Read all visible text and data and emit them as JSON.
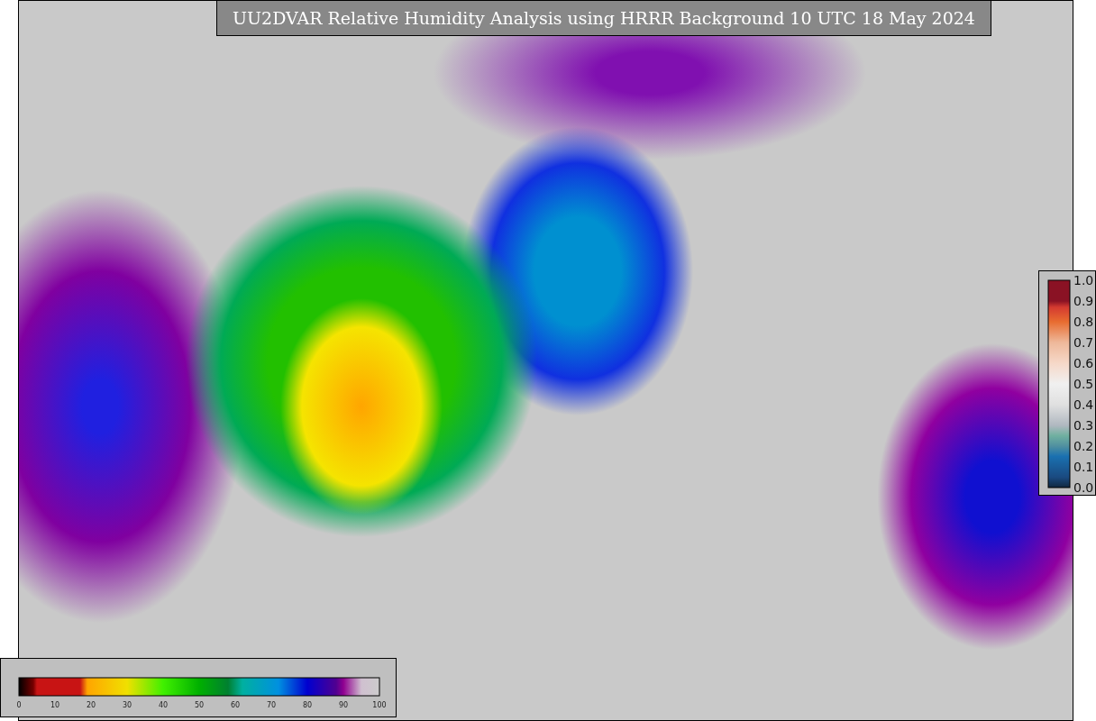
{
  "title": "UU2DVAR Relative Humidity Analysis using HRRR Background 10 UTC 18 May 2024",
  "colorbar_bottom": {
    "ticks": [
      "0",
      "10",
      "20",
      "30",
      "40",
      "50",
      "60",
      "70",
      "80",
      "90",
      "100"
    ]
  },
  "colorbar_right": {
    "ticks": [
      "1.0",
      "0.9",
      "0.8",
      "0.7",
      "0.6",
      "0.5",
      "0.4",
      "0.3",
      "0.2",
      "0.1",
      "0.0"
    ]
  }
}
